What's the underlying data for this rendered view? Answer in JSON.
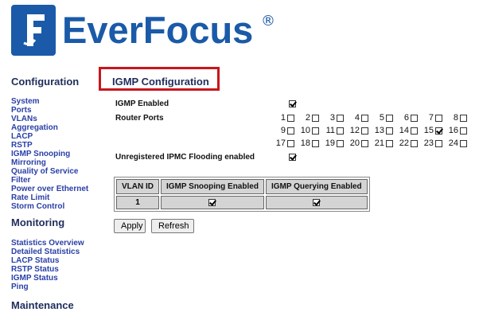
{
  "brand": {
    "name": "EverFocus",
    "reg": "®",
    "color": "#1a5aa8"
  },
  "sidebar": {
    "configuration": {
      "heading": "Configuration",
      "items": [
        "System",
        "Ports",
        "VLANs",
        "Aggregation",
        "LACP",
        "RSTP",
        "IGMP Snooping",
        "Mirroring",
        "Quality of Service",
        "Filter",
        "Power over Ethernet",
        "Rate Limit",
        "Storm Control"
      ]
    },
    "monitoring": {
      "heading": "Monitoring",
      "items": [
        "Statistics Overview",
        "Detailed Statistics",
        "LACP Status",
        "RSTP Status",
        "IGMP Status",
        "Ping"
      ]
    },
    "maintenance": {
      "heading": "Maintenance"
    }
  },
  "main": {
    "title": "IGMP Configuration",
    "igmp_enabled_label": "IGMP Enabled",
    "igmp_enabled": true,
    "router_ports_label": "Router Ports",
    "router_ports": [
      {
        "n": "1",
        "checked": false
      },
      {
        "n": "2",
        "checked": false
      },
      {
        "n": "3",
        "checked": false
      },
      {
        "n": "4",
        "checked": false
      },
      {
        "n": "5",
        "checked": false
      },
      {
        "n": "6",
        "checked": false
      },
      {
        "n": "7",
        "checked": false
      },
      {
        "n": "8",
        "checked": false
      },
      {
        "n": "9",
        "checked": false
      },
      {
        "n": "10",
        "checked": false
      },
      {
        "n": "11",
        "checked": false
      },
      {
        "n": "12",
        "checked": false
      },
      {
        "n": "13",
        "checked": false
      },
      {
        "n": "14",
        "checked": false
      },
      {
        "n": "15",
        "checked": true
      },
      {
        "n": "16",
        "checked": false
      },
      {
        "n": "17",
        "checked": false
      },
      {
        "n": "18",
        "checked": false
      },
      {
        "n": "19",
        "checked": false
      },
      {
        "n": "20",
        "checked": false
      },
      {
        "n": "21",
        "checked": false
      },
      {
        "n": "22",
        "checked": false
      },
      {
        "n": "23",
        "checked": false
      },
      {
        "n": "24",
        "checked": false
      }
    ],
    "flooding_label": "Unregistered IPMC Flooding enabled",
    "flooding_enabled": true,
    "vlan_table": {
      "headers": [
        "VLAN ID",
        "IGMP Snooping Enabled",
        "IGMP Querying Enabled"
      ],
      "rows": [
        {
          "vlan_id": "1",
          "snooping": true,
          "querying": true
        }
      ]
    },
    "buttons": {
      "apply": "Apply",
      "refresh": "Refresh"
    },
    "highlight_color": "#c8161d"
  }
}
